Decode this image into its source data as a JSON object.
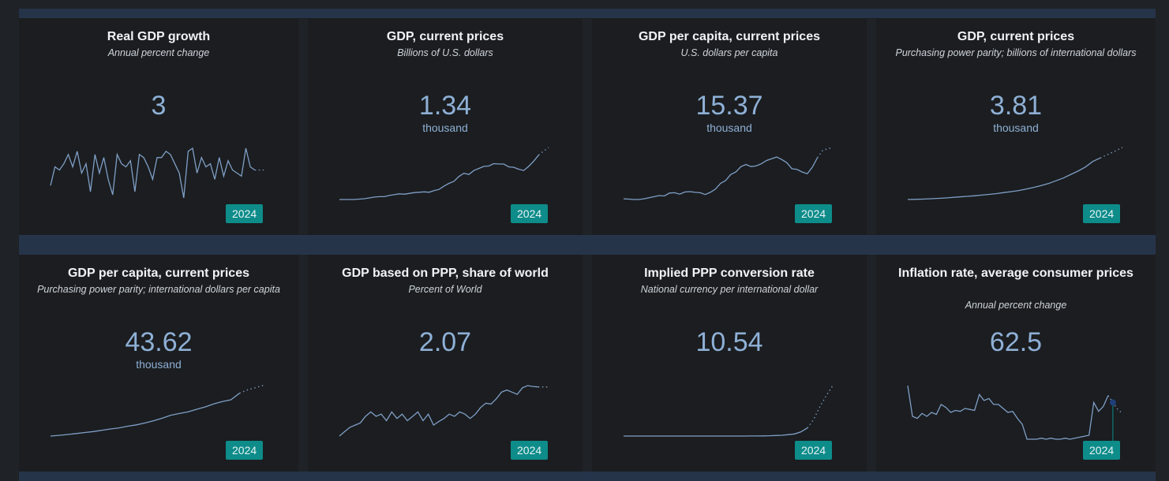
{
  "cards": [
    {
      "title": "Real GDP growth",
      "subtitle": "Annual percent change",
      "value": "3",
      "unit": "",
      "year": "2024"
    },
    {
      "title": "GDP, current prices",
      "subtitle": "Billions of U.S. dollars",
      "value": "1.34",
      "unit": "thousand",
      "year": "2024"
    },
    {
      "title": "GDP per capita, current prices",
      "subtitle": "U.S. dollars per capita",
      "value": "15.37",
      "unit": "thousand",
      "year": "2024"
    },
    {
      "title": "GDP, current prices",
      "subtitle": "Purchasing power parity; billions of international dollars",
      "value": "3.81",
      "unit": "thousand",
      "year": "2024"
    },
    {
      "title": "GDP per capita, current prices",
      "subtitle": "Purchasing power parity; international dollars per capita",
      "value": "43.62",
      "unit": "thousand",
      "year": "2024"
    },
    {
      "title": "GDP based on PPP, share of world",
      "subtitle": "Percent of World",
      "value": "2.07",
      "unit": "",
      "year": "2024"
    },
    {
      "title": "Implied PPP conversion rate",
      "subtitle": "National currency per international dollar",
      "value": "10.54",
      "unit": "",
      "year": "2024"
    },
    {
      "title": "Inflation rate, average consumer prices",
      "subtitle": "Annual percent change",
      "value": "62.5",
      "unit": "",
      "year": "2024"
    }
  ],
  "colors": {
    "line": "#7f9fc6",
    "badge": "#0d8c8a",
    "value": "#8eb0d6",
    "band": "#263449",
    "card": "#1b1d20"
  },
  "chart_data": [
    {
      "type": "line",
      "title": "Real GDP growth",
      "series": [
        {
          "values": [
            -2,
            4,
            3,
            5,
            8,
            4,
            9,
            2,
            5,
            -4,
            8,
            2,
            7,
            0,
            -5,
            8,
            5,
            4,
            6,
            -4,
            8,
            7,
            4,
            0,
            7,
            7,
            9,
            8,
            5,
            2,
            -6,
            9,
            10,
            2,
            7,
            4,
            5,
            0,
            7,
            1,
            6,
            3,
            2,
            1,
            10,
            4,
            3,
            3,
            3
          ]
        }
      ],
      "projected_from_index": 46
    },
    {
      "type": "line",
      "title": "GDP, current prices",
      "series": [
        {
          "values": [
            0.05,
            0.05,
            0.05,
            0.05,
            0.06,
            0.07,
            0.09,
            0.11,
            0.12,
            0.12,
            0.15,
            0.17,
            0.19,
            0.18,
            0.2,
            0.22,
            0.23,
            0.24,
            0.23,
            0.27,
            0.3,
            0.38,
            0.45,
            0.5,
            0.62,
            0.7,
            0.67,
            0.77,
            0.82,
            0.87,
            0.88,
            0.94,
            0.93,
            0.93,
            0.86,
            0.85,
            0.8,
            0.77,
            0.87,
            1.0,
            1.15,
            1.25,
            1.34
          ]
        }
      ],
      "projected_from_index": 40
    },
    {
      "type": "line",
      "title": "GDP per capita, current prices",
      "series": [
        {
          "values": [
            1.0,
            0.9,
            0.8,
            0.8,
            1.0,
            1.3,
            1.6,
            1.9,
            1.8,
            2.6,
            2.7,
            2.3,
            2.9,
            3.0,
            2.8,
            2.7,
            2.2,
            2.8,
            3.7,
            5.3,
            6.1,
            7.8,
            8.5,
            10.0,
            10.6,
            10.0,
            10.2,
            10.8,
            11.7,
            12.2,
            12.7,
            12.0,
            11.1,
            9.4,
            9.2,
            8.5,
            8.0,
            9.8,
            12.5,
            14.5,
            15.0,
            15.37
          ]
        }
      ],
      "projected_from_index": 38
    },
    {
      "type": "line",
      "title": "GDP, current prices (PPP)",
      "series": [
        {
          "values": [
            0.05,
            0.06,
            0.08,
            0.1,
            0.13,
            0.16,
            0.2,
            0.24,
            0.28,
            0.32,
            0.37,
            0.42,
            0.48,
            0.55,
            0.62,
            0.7,
            0.8,
            0.92,
            1.05,
            1.2,
            1.4,
            1.6,
            1.85,
            2.1,
            2.4,
            2.8,
            3.05,
            3.3,
            3.55,
            3.81
          ]
        }
      ],
      "projected_from_index": 26
    },
    {
      "type": "line",
      "title": "GDP per capita, current prices (PPP)",
      "series": [
        {
          "values": [
            0.5,
            1.1,
            1.8,
            2.6,
            3.5,
            4.3,
            5.4,
            6.5,
            7.4,
            8.8,
            9.9,
            11.5,
            13.4,
            15.5,
            18.0,
            19.5,
            20.8,
            23.0,
            25.0,
            27.5,
            29.5,
            31.0,
            36.5,
            39.5,
            41.5,
            43.62
          ]
        }
      ],
      "projected_from_index": 22
    },
    {
      "type": "line",
      "title": "GDP based on PPP, share of world",
      "series": [
        {
          "values": [
            0.95,
            1.05,
            1.15,
            1.2,
            1.25,
            1.4,
            1.5,
            1.4,
            1.45,
            1.3,
            1.5,
            1.35,
            1.45,
            1.3,
            1.4,
            1.5,
            1.3,
            1.45,
            1.2,
            1.28,
            1.35,
            1.45,
            1.4,
            1.5,
            1.45,
            1.35,
            1.45,
            1.6,
            1.7,
            1.68,
            1.8,
            1.95,
            2.0,
            1.95,
            1.9,
            2.05,
            2.1,
            2.08,
            2.07,
            2.07,
            2.07
          ]
        }
      ],
      "projected_from_index": 38
    },
    {
      "type": "line",
      "title": "Implied PPP conversion rate",
      "series": [
        {
          "values": [
            0.01,
            0.01,
            0.01,
            0.01,
            0.01,
            0.01,
            0.01,
            0.01,
            0.01,
            0.01,
            0.01,
            0.01,
            0.01,
            0.01,
            0.01,
            0.01,
            0.01,
            0.01,
            0.01,
            0.01,
            0.02,
            0.03,
            0.05,
            0.08,
            0.12,
            0.18,
            0.3,
            0.45,
            0.9,
            1.7,
            3.5,
            6.2,
            8.5,
            10.54
          ]
        }
      ],
      "projected_from_index": 29
    },
    {
      "type": "line",
      "title": "Inflation rate, average consumer prices",
      "series": [
        {
          "values": [
            64,
            33,
            31,
            36,
            33,
            37,
            35,
            45,
            42,
            37,
            39,
            38,
            41,
            40,
            39,
            55,
            49,
            51,
            45,
            45,
            41,
            37,
            38,
            31,
            25,
            10,
            10,
            10,
            11,
            10,
            11,
            10,
            10,
            11,
            10,
            11,
            12,
            13,
            14,
            47,
            38,
            43,
            54,
            47,
            40,
            36
          ]
        }
      ],
      "projected_from_index": 42,
      "marker": {
        "year": "2024",
        "value": 62.5
      }
    }
  ]
}
